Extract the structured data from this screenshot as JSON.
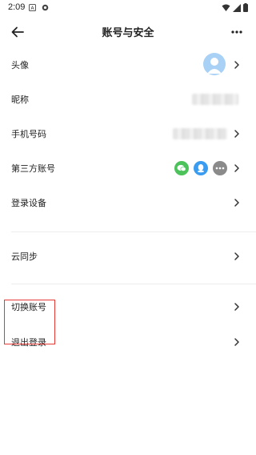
{
  "status_bar": {
    "time": "2:09",
    "icons": [
      "a-notification-icon",
      "settings-notification-icon",
      "wifi-icon",
      "signal-icon",
      "battery-icon"
    ]
  },
  "header": {
    "title": "账号与安全",
    "back_icon": "back-arrow-icon",
    "more_icon": "more-dots-icon"
  },
  "rows": [
    {
      "label": "头像",
      "trailing": "avatar"
    },
    {
      "label": "昵称",
      "trailing": "blurred-text"
    },
    {
      "label": "手机号码",
      "trailing": "blurred-text"
    },
    {
      "label": "第三方账号",
      "trailing": "third-party-icons"
    },
    {
      "label": "登录设备",
      "trailing": "none"
    },
    {
      "label": "云同步",
      "trailing": "none"
    },
    {
      "label": "切换账号",
      "trailing": "none"
    },
    {
      "label": "退出登录",
      "trailing": "none"
    }
  ],
  "third_party": [
    {
      "name": "wechat-icon",
      "color": "#4cc25a"
    },
    {
      "name": "qq-icon",
      "color": "#3a9cf0"
    },
    {
      "name": "more-icon",
      "color": "#8a8a8a"
    }
  ],
  "colors": {
    "highlight": "#e53935",
    "avatar_bg": "#a9d0f5"
  }
}
